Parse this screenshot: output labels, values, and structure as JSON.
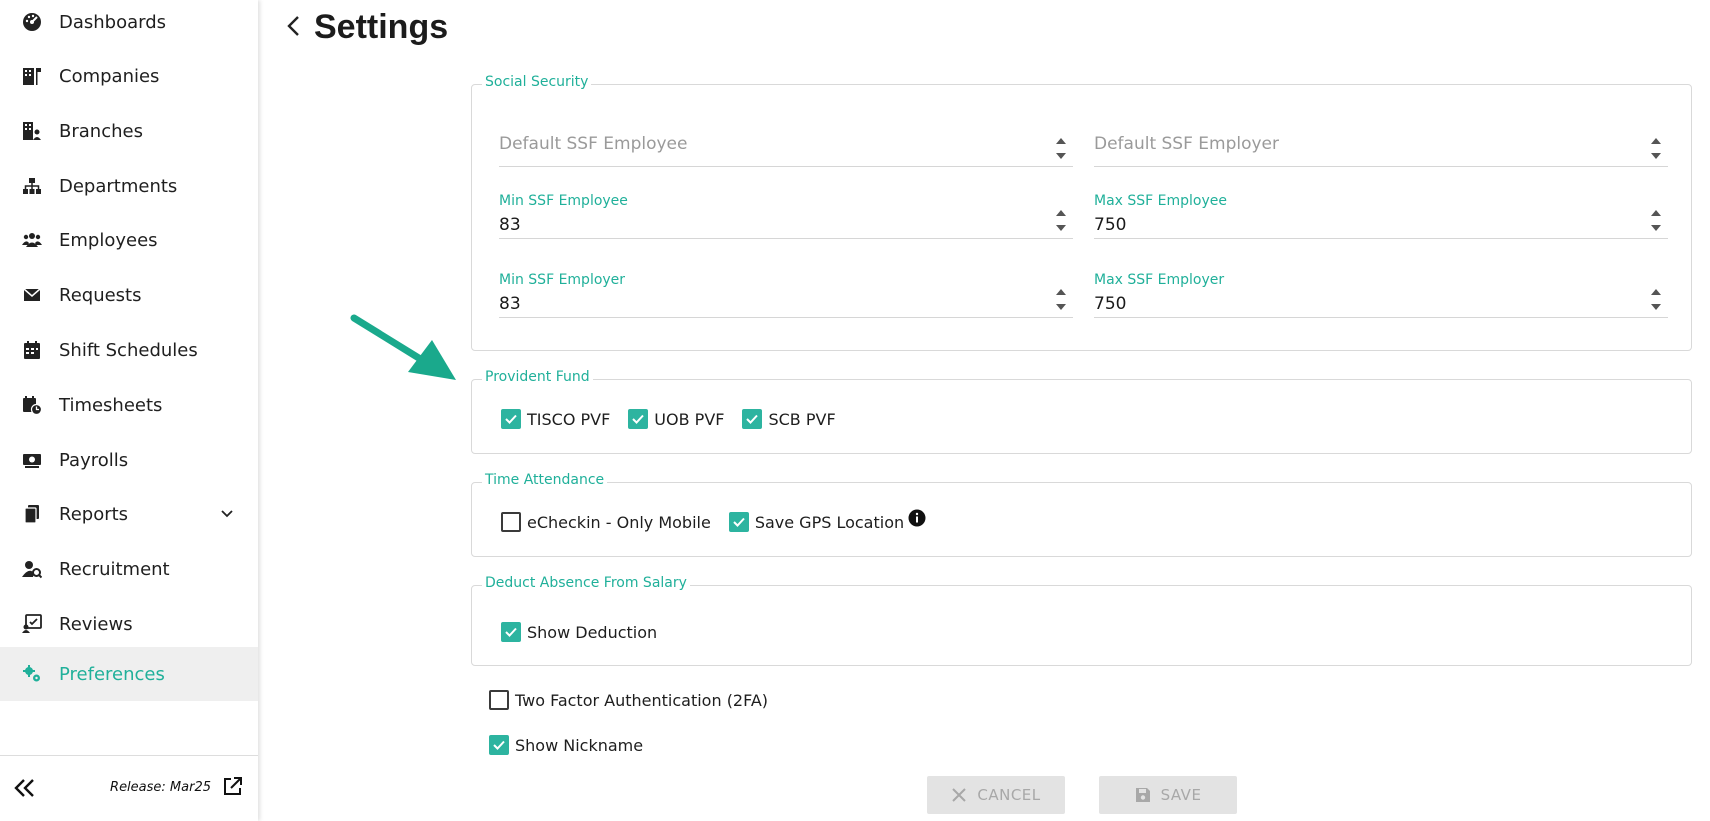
{
  "sidebar": {
    "items": [
      {
        "label": "Dashboards",
        "icon": "gauge-icon"
      },
      {
        "label": "Companies",
        "icon": "building-flag-icon"
      },
      {
        "label": "Branches",
        "icon": "building-user-icon"
      },
      {
        "label": "Departments",
        "icon": "sitemap-icon"
      },
      {
        "label": "Employees",
        "icon": "users-icon"
      },
      {
        "label": "Requests",
        "icon": "envelope-icon"
      },
      {
        "label": "Shift Schedules",
        "icon": "calendar-icon"
      },
      {
        "label": "Timesheets",
        "icon": "calendar-clock-icon"
      },
      {
        "label": "Payrolls",
        "icon": "money-icon"
      },
      {
        "label": "Reports",
        "icon": "documents-icon"
      },
      {
        "label": "Recruitment",
        "icon": "user-search-icon"
      },
      {
        "label": "Reviews",
        "icon": "review-icon"
      },
      {
        "label": "Preferences",
        "icon": "gears-icon"
      }
    ],
    "active_item": "Preferences",
    "release_text": "Release: Mar25"
  },
  "header": {
    "title": "Settings"
  },
  "social_security": {
    "legend": "Social Security",
    "default_ssf_employee_placeholder": "Default SSF Employee",
    "default_ssf_employer_placeholder": "Default SSF Employer",
    "min_ssf_employee_label": "Min SSF Employee",
    "min_ssf_employee_value": "83",
    "max_ssf_employee_label": "Max SSF Employee",
    "max_ssf_employee_value": "750",
    "min_ssf_employer_label": "Min SSF Employer",
    "min_ssf_employer_value": "83",
    "max_ssf_employer_label": "Max SSF Employer",
    "max_ssf_employer_value": "750"
  },
  "provident_fund": {
    "legend": "Provident Fund",
    "options": [
      {
        "label": "TISCO PVF",
        "checked": true
      },
      {
        "label": "UOB PVF",
        "checked": true
      },
      {
        "label": "SCB PVF",
        "checked": true
      }
    ]
  },
  "time_attendance": {
    "legend": "Time Attendance",
    "options": [
      {
        "label": "eCheckin - Only Mobile",
        "checked": false
      },
      {
        "label": "Save GPS Location",
        "checked": true
      }
    ]
  },
  "deduct_absence": {
    "legend": "Deduct Absence From Salary",
    "show_deduction_label": "Show Deduction",
    "show_deduction_checked": true
  },
  "standalone": {
    "two_factor_label": "Two Factor Authentication (2FA)",
    "two_factor_checked": false,
    "show_nickname_label": "Show Nickname",
    "show_nickname_checked": true
  },
  "actions": {
    "cancel_label": "CANCEL",
    "save_label": "SAVE"
  },
  "colors": {
    "accent": "#20b09a",
    "checkbox": "#2db4a0",
    "annotation_arrow": "#1aa98c"
  }
}
